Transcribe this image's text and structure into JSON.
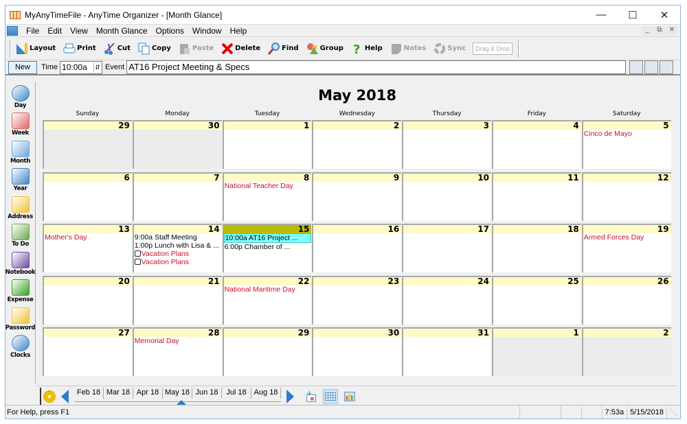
{
  "window": {
    "title": "MyAnyTimeFile - AnyTime Organizer - [Month Glance]",
    "controls": [
      "minimize",
      "maximize",
      "close"
    ]
  },
  "menu": [
    "File",
    "Edit",
    "View",
    "Month Glance",
    "Options",
    "Window",
    "Help"
  ],
  "toolbar": [
    {
      "label": "Layout",
      "icon": "layout-icon",
      "enabled": true
    },
    {
      "label": "Print",
      "icon": "printer-icon",
      "enabled": true
    },
    {
      "label": "Cut",
      "icon": "scissors-icon",
      "enabled": true
    },
    {
      "label": "Copy",
      "icon": "copy-icon",
      "enabled": true
    },
    {
      "label": "Paste",
      "icon": "paste-icon",
      "enabled": false
    },
    {
      "label": "Delete",
      "icon": "delete-x-icon",
      "enabled": true
    },
    {
      "label": "Find",
      "icon": "magnifier-icon",
      "enabled": true
    },
    {
      "label": "Group",
      "icon": "shapes-icon",
      "enabled": true
    },
    {
      "label": "Help",
      "icon": "question-icon",
      "enabled": true
    },
    {
      "label": "Notes",
      "icon": "note-icon",
      "enabled": false
    },
    {
      "label": "Sync",
      "icon": "sync-icon",
      "enabled": false
    }
  ],
  "drag_drop_label": "Drag & Drop",
  "eventbar": {
    "new_label": "New",
    "time_label": "Time",
    "time_value": "10:00a",
    "event_label": "Event",
    "event_value": "AT16 Project Meeting & Specs"
  },
  "sidebar": [
    "Day",
    "Week",
    "Month",
    "Year",
    "Address",
    "To Do",
    "Notebook",
    "Expense",
    "Password",
    "Clocks"
  ],
  "calendar": {
    "title": "May 2018",
    "days_of_week": [
      "Sunday",
      "Monday",
      "Tuesday",
      "Wednesday",
      "Thursday",
      "Friday",
      "Saturday"
    ],
    "weeks": [
      [
        {
          "day": "29",
          "other": true,
          "events": []
        },
        {
          "day": "30",
          "other": true,
          "events": []
        },
        {
          "day": "1",
          "events": []
        },
        {
          "day": "2",
          "events": []
        },
        {
          "day": "3",
          "events": []
        },
        {
          "day": "4",
          "events": []
        },
        {
          "day": "5",
          "events": [
            {
              "text": "Cinco de Mayo",
              "type": "holiday"
            }
          ]
        }
      ],
      [
        {
          "day": "6",
          "events": []
        },
        {
          "day": "7",
          "events": []
        },
        {
          "day": "8",
          "events": [
            {
              "text": "National Teacher Day",
              "type": "holiday"
            }
          ]
        },
        {
          "day": "9",
          "events": []
        },
        {
          "day": "10",
          "events": []
        },
        {
          "day": "11",
          "events": []
        },
        {
          "day": "12",
          "events": []
        }
      ],
      [
        {
          "day": "13",
          "events": [
            {
              "text": "Mother's Day",
              "type": "holiday"
            }
          ]
        },
        {
          "day": "14",
          "events": [
            {
              "text": "9:00a Staff Meeting",
              "type": "appt"
            },
            {
              "text": "1:00p Lunch with Lisa & ...",
              "type": "appt"
            },
            {
              "text": "Vacation Plans",
              "type": "todo"
            },
            {
              "text": "Vacation Plans",
              "type": "todo"
            }
          ]
        },
        {
          "day": "15",
          "today": true,
          "events": [
            {
              "text": "10:00a AT16 Project ...",
              "type": "selected"
            },
            {
              "text": "6:00p Chamber of ...",
              "type": "appt"
            }
          ]
        },
        {
          "day": "16",
          "events": []
        },
        {
          "day": "17",
          "events": []
        },
        {
          "day": "18",
          "events": []
        },
        {
          "day": "19",
          "events": [
            {
              "text": "Armed Forces Day",
              "type": "holiday"
            }
          ]
        }
      ],
      [
        {
          "day": "20",
          "events": []
        },
        {
          "day": "21",
          "events": []
        },
        {
          "day": "22",
          "events": [
            {
              "text": "National Maritime Day",
              "type": "holiday"
            }
          ]
        },
        {
          "day": "23",
          "events": []
        },
        {
          "day": "24",
          "events": []
        },
        {
          "day": "25",
          "events": []
        },
        {
          "day": "26",
          "events": []
        }
      ],
      [
        {
          "day": "27",
          "events": []
        },
        {
          "day": "28",
          "events": [
            {
              "text": "Memorial Day",
              "type": "holiday"
            }
          ]
        },
        {
          "day": "29",
          "events": []
        },
        {
          "day": "30",
          "events": []
        },
        {
          "day": "31",
          "events": []
        },
        {
          "day": "1",
          "other": true,
          "events": []
        },
        {
          "day": "2",
          "other": true,
          "events": []
        }
      ]
    ]
  },
  "navigator": {
    "months": [
      "Feb 18",
      "Mar 18",
      "Apr 18",
      "May 18",
      "Jun 18",
      "Jul 18",
      "Aug 18"
    ],
    "selected": "May 18"
  },
  "status": {
    "help": "For Help, press F1",
    "time": "7:53a",
    "date": "5/15/2018"
  },
  "colors": {
    "holiday": "#c8102e",
    "day_header": "#fffac6",
    "today_header": "#bcbc00",
    "selected_event": "#7fffff",
    "accent": "#2d7bd0"
  }
}
